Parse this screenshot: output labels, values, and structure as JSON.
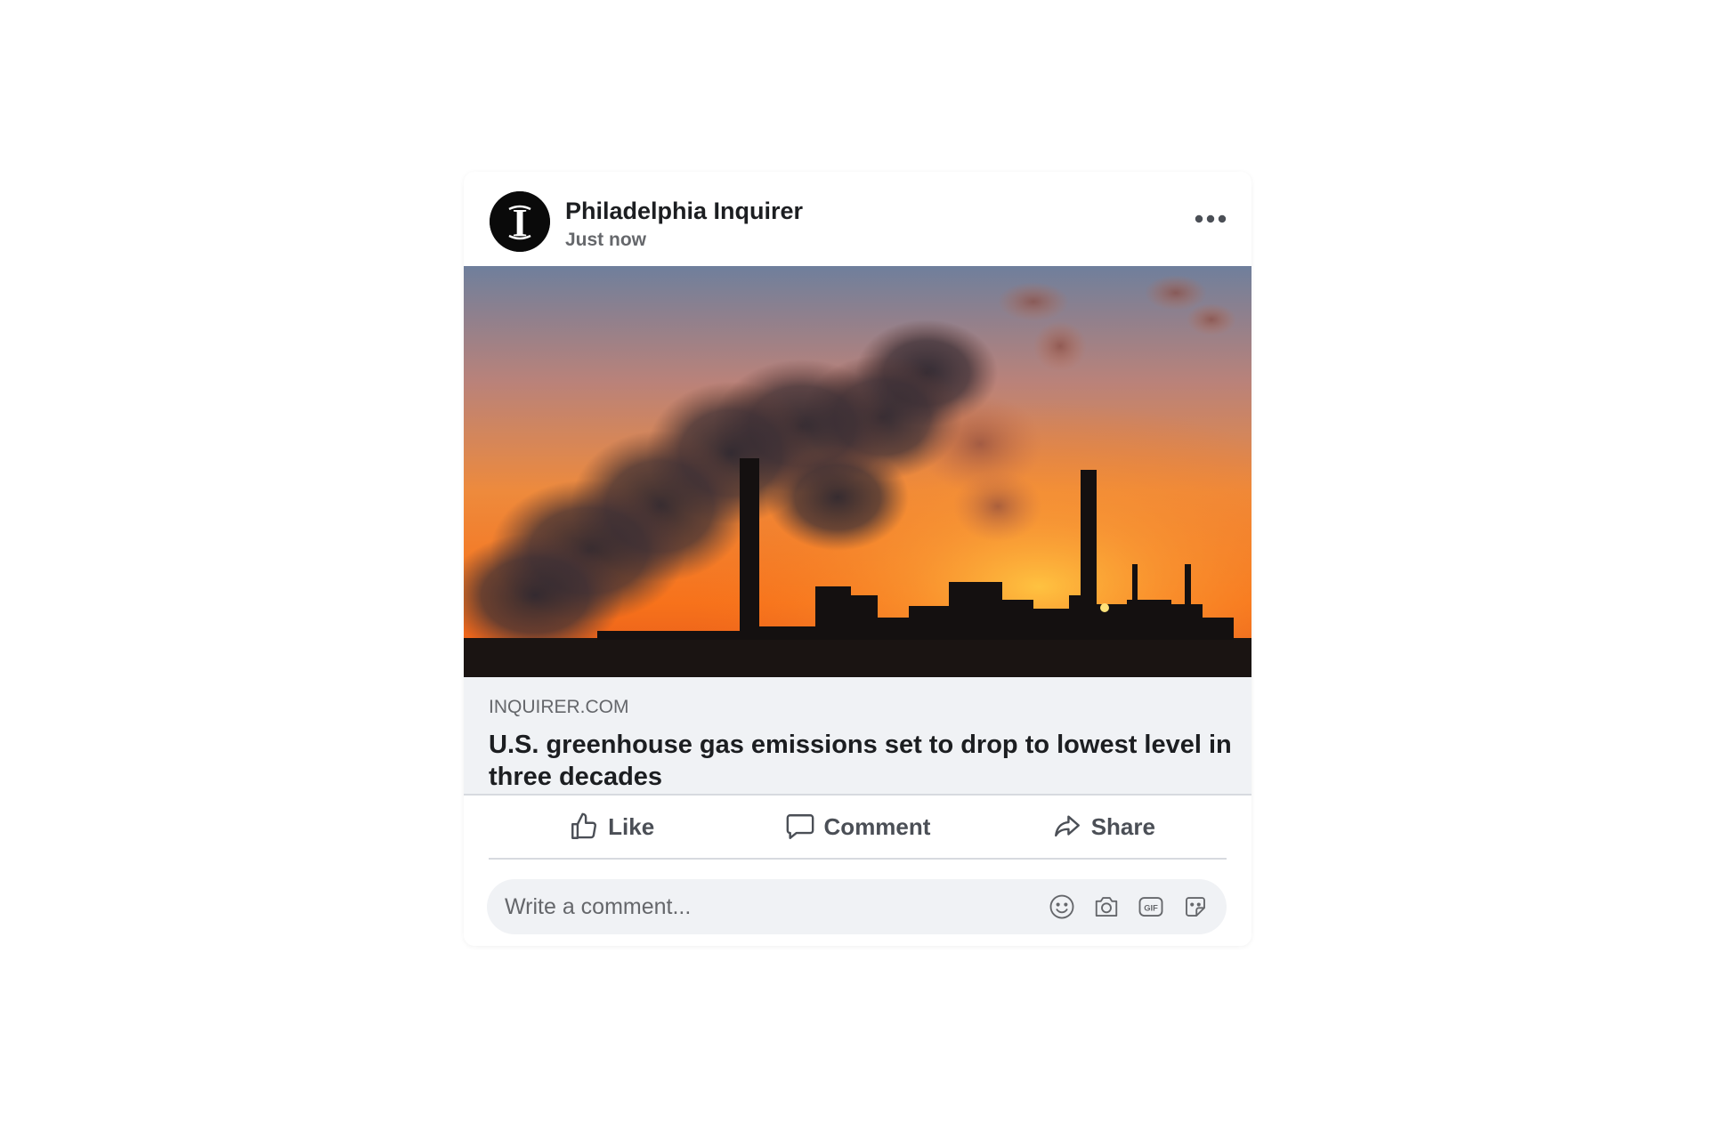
{
  "post": {
    "author": "Philadelphia Inquirer",
    "timestamp": "Just now",
    "logo_letter": "I",
    "more_icon": "more-horizontal-icon",
    "image_icon": "power-plant-sunset-photo"
  },
  "link": {
    "domain": "INQUIRER.COM",
    "title": "U.S. greenhouse gas emissions set to drop to lowest level in three decades"
  },
  "actions": {
    "like_label": "Like",
    "comment_label": "Comment",
    "share_label": "Share"
  },
  "comment": {
    "placeholder": "Write a comment...",
    "icons": [
      "emoji-icon",
      "camera-icon",
      "gif-icon",
      "sticker-icon"
    ]
  },
  "colors": {
    "text_primary": "#1c1e21",
    "text_secondary": "#65676b",
    "surface": "#f0f2f5",
    "divider": "#d7dadf"
  }
}
